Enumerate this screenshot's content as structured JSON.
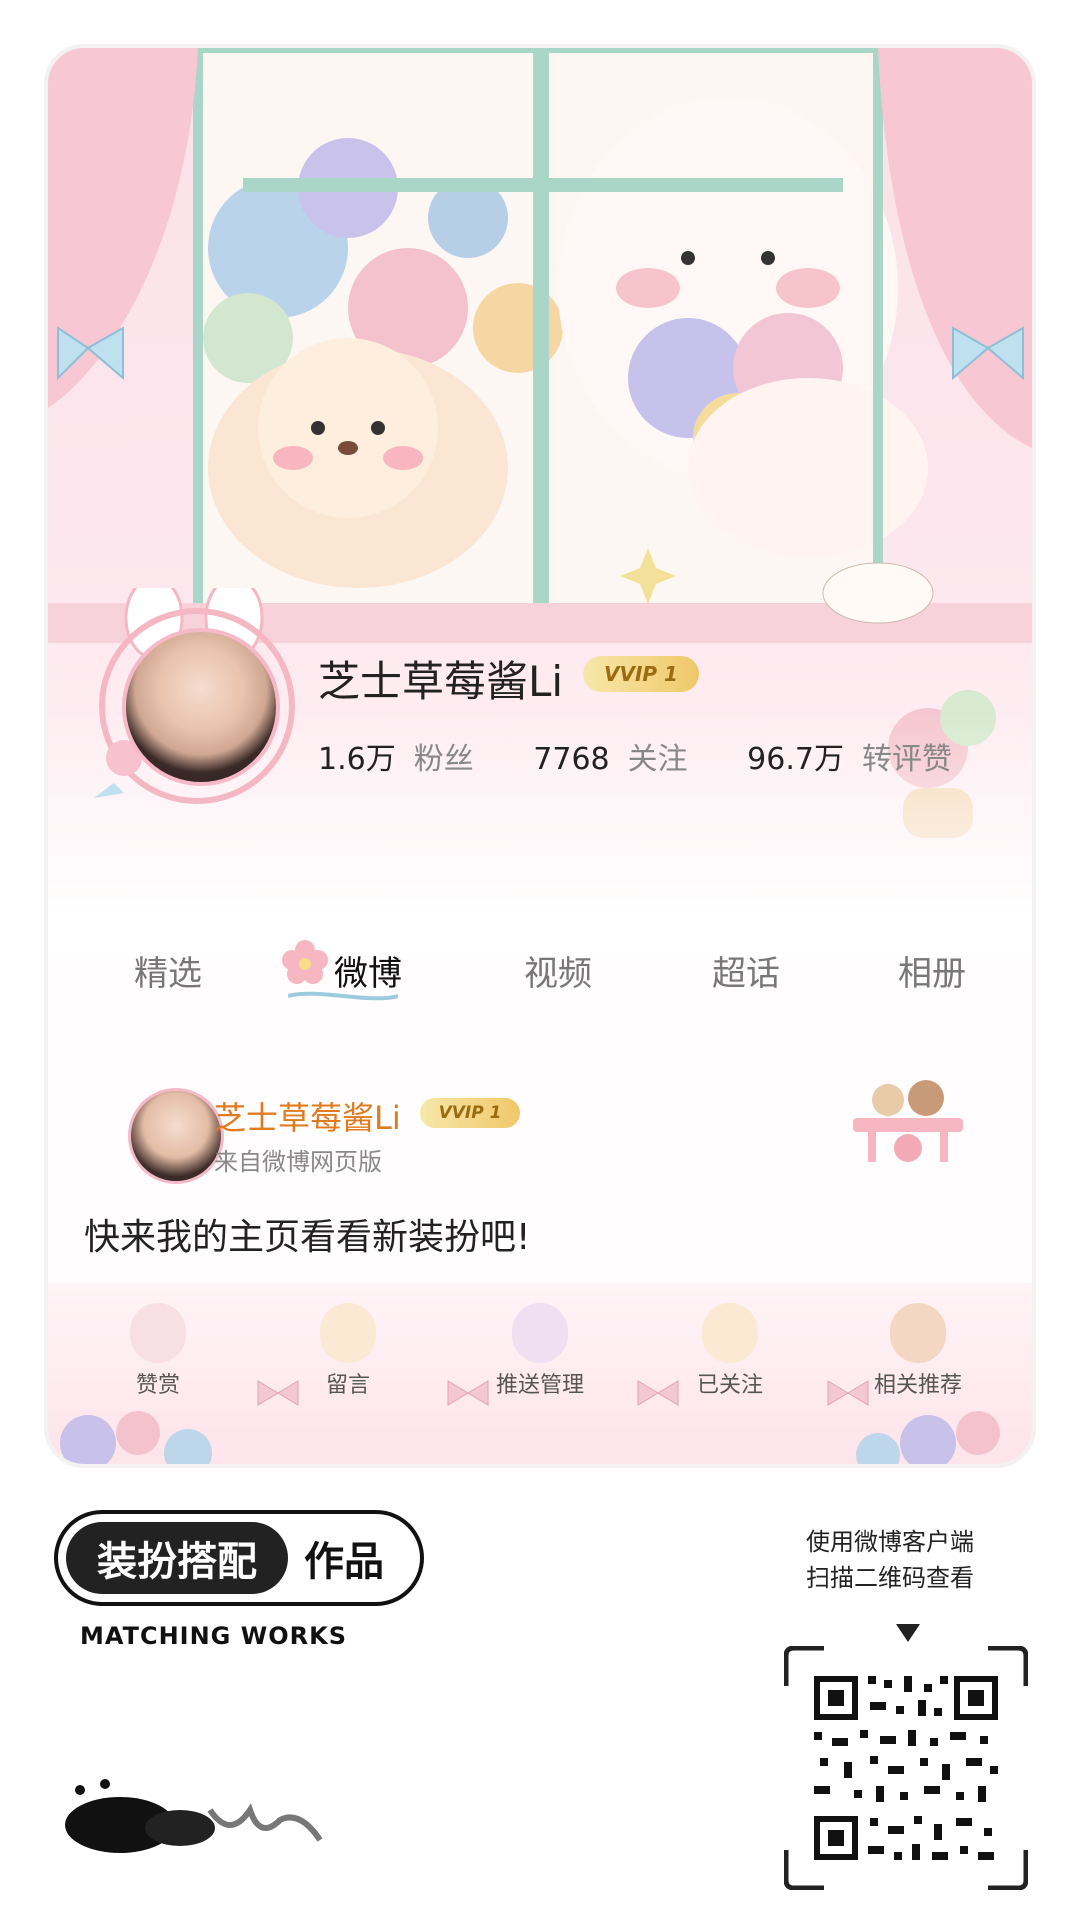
{
  "profile": {
    "name": "芝士草莓酱Li",
    "vip_badge": "VVIP 1",
    "stats": [
      {
        "value": "1.6万",
        "label": "粉丝"
      },
      {
        "value": "7768",
        "label": "关注"
      },
      {
        "value": "96.7万",
        "label": "转评赞"
      }
    ]
  },
  "tabs": [
    {
      "label": "精选"
    },
    {
      "label": "微博"
    },
    {
      "label": "视频"
    },
    {
      "label": "超话"
    },
    {
      "label": "相册"
    }
  ],
  "post": {
    "author": "芝士草莓酱Li",
    "vip_badge": "VVIP 1",
    "source": "来自微博网页版",
    "text": "快来我的主页看看新装扮吧!"
  },
  "actions": [
    {
      "label": "赞赏"
    },
    {
      "label": "留言"
    },
    {
      "label": "推送管理"
    },
    {
      "label": "已关注"
    },
    {
      "label": "相关推荐"
    }
  ],
  "footer": {
    "badge_dark": "装扮搭配",
    "badge_light": "作品",
    "subtitle": "MATCHING WORKS",
    "qr_caption_line1": "使用微博客户端",
    "qr_caption_line2": "扫描二维码查看"
  },
  "colors": {
    "card_bg": "#fffdfd",
    "header_pink": "#fbe1e8",
    "window_green": "#a9d6c6",
    "username_orange": "#e07a1f",
    "vip_gold": "#f0c86a"
  }
}
